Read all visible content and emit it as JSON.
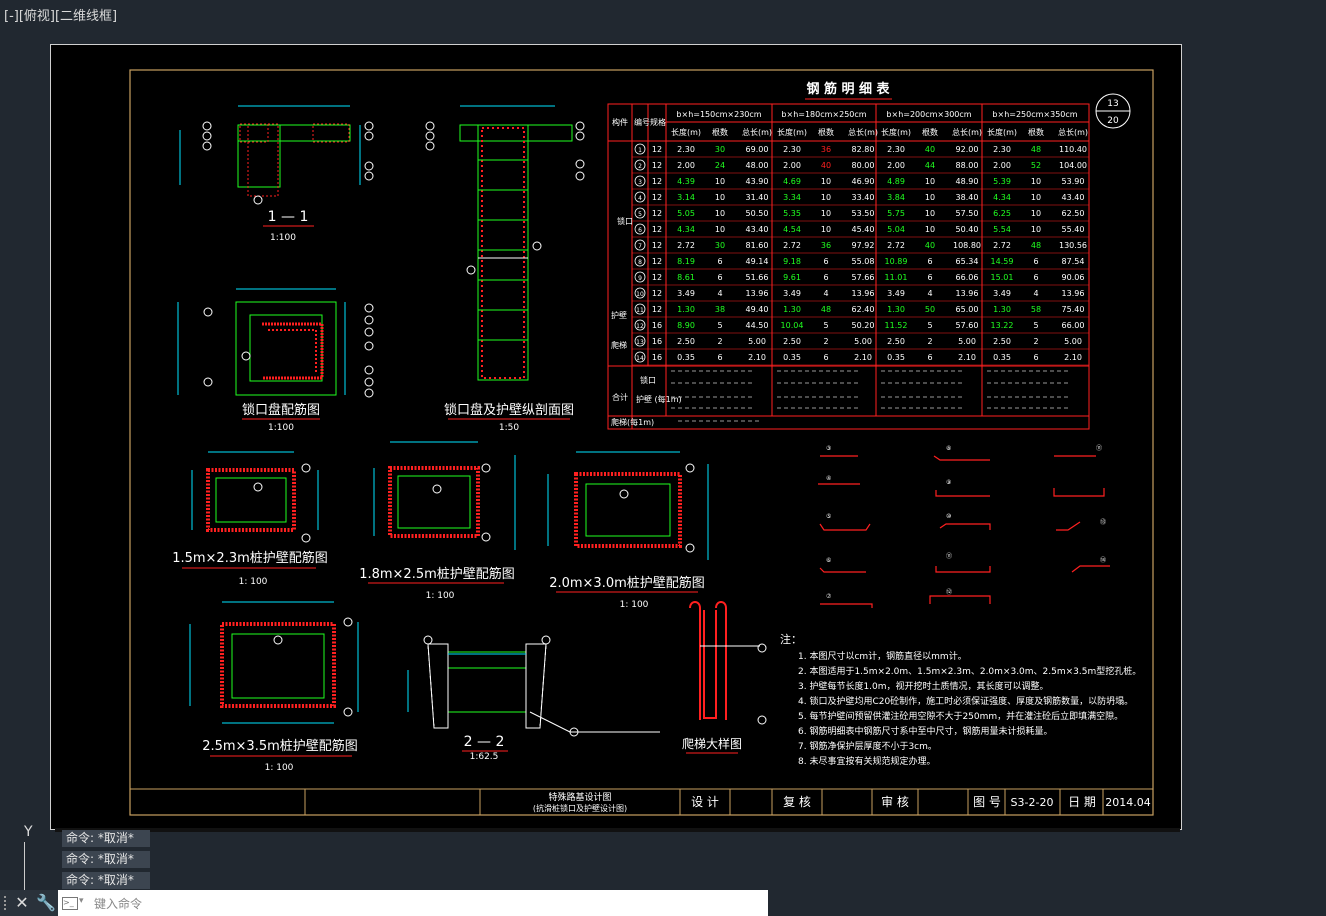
{
  "viewport": {
    "label": "[-][俯视][二维线框]"
  },
  "drawing": {
    "table_title": "钢 筋 明 细 表",
    "sheet_badge": {
      "num": "13",
      "den": "20"
    },
    "table_header": {
      "col1": "构件",
      "col2": "编号",
      "col3": "规格",
      "groups": [
        "b×h=150cm×230cm",
        "b×h=180cm×250cm",
        "b×h=200cm×300cm",
        "b×h=250cm×350cm"
      ],
      "sub": [
        "长度(m)",
        "根数",
        "总长(m)"
      ]
    },
    "table_rows": [
      [
        "1",
        "12",
        "2.30",
        "30",
        "69.00",
        "2.30",
        "36",
        "82.80",
        "2.30",
        "40",
        "92.00",
        "2.30",
        "48",
        "110.40"
      ],
      [
        "2",
        "12",
        "2.00",
        "24",
        "48.00",
        "2.00",
        "40",
        "80.00",
        "2.00",
        "44",
        "88.00",
        "2.00",
        "52",
        "104.00"
      ],
      [
        "3",
        "12",
        "4.39",
        "10",
        "43.90",
        "4.69",
        "10",
        "46.90",
        "4.89",
        "10",
        "48.90",
        "5.39",
        "10",
        "53.90"
      ],
      [
        "4",
        "12",
        "3.14",
        "10",
        "31.40",
        "3.34",
        "10",
        "33.40",
        "3.84",
        "10",
        "38.40",
        "4.34",
        "10",
        "43.40"
      ],
      [
        "5",
        "12",
        "5.05",
        "10",
        "50.50",
        "5.35",
        "10",
        "53.50",
        "5.75",
        "10",
        "57.50",
        "6.25",
        "10",
        "62.50"
      ],
      [
        "6",
        "12",
        "4.34",
        "10",
        "43.40",
        "4.54",
        "10",
        "45.40",
        "5.04",
        "10",
        "50.40",
        "5.54",
        "10",
        "55.40"
      ],
      [
        "7",
        "12",
        "2.72",
        "30",
        "81.60",
        "2.72",
        "36",
        "97.92",
        "2.72",
        "40",
        "108.80",
        "2.72",
        "48",
        "130.56"
      ],
      [
        "8",
        "12",
        "8.19",
        "6",
        "49.14",
        "9.18",
        "6",
        "55.08",
        "10.89",
        "6",
        "65.34",
        "14.59",
        "6",
        "87.54"
      ],
      [
        "9",
        "12",
        "8.61",
        "6",
        "51.66",
        "9.61",
        "6",
        "57.66",
        "11.01",
        "6",
        "66.06",
        "15.01",
        "6",
        "90.06"
      ],
      [
        "10",
        "12",
        "3.49",
        "4",
        "13.96",
        "3.49",
        "4",
        "13.96",
        "3.49",
        "4",
        "13.96",
        "3.49",
        "4",
        "13.96"
      ],
      [
        "11",
        "12",
        "1.30",
        "38",
        "49.40",
        "1.30",
        "48",
        "62.40",
        "1.30",
        "50",
        "65.00",
        "1.30",
        "58",
        "75.40"
      ],
      [
        "12",
        "16",
        "8.90",
        "5",
        "44.50",
        "10.04",
        "5",
        "50.20",
        "11.52",
        "5",
        "57.60",
        "13.22",
        "5",
        "66.00"
      ],
      [
        "13",
        "16",
        "2.50",
        "2",
        "5.00",
        "2.50",
        "2",
        "5.00",
        "2.50",
        "2",
        "5.00",
        "2.50",
        "2",
        "5.00"
      ],
      [
        "14",
        "16",
        "0.35",
        "6",
        "2.10",
        "0.35",
        "6",
        "2.10",
        "0.35",
        "6",
        "2.10",
        "0.35",
        "6",
        "2.10"
      ]
    ],
    "table_side_labels": {
      "top": "锁口",
      "guard": "护壁",
      "ladder": "爬梯"
    },
    "table_total": {
      "label": "合计",
      "r1": "锁口",
      "r2": "护壁 (每1m)",
      "r3": "爬梯(每1m)"
    },
    "views": {
      "sec11": "1 — 1",
      "sec11_scale": "1:100",
      "plan": "锁口盘配筋图",
      "plan_scale": "1:100",
      "long": "锁口盘及护壁纵剖面图",
      "long_scale": "1:50",
      "p1": "1.5m×2.3m桩护壁配筋图",
      "p1_scale": "1: 100",
      "p2": "1.8m×2.5m桩护壁配筋图",
      "p2_scale": "1: 100",
      "p3": "2.0m×3.0m桩护壁配筋图",
      "p3_scale": "1: 100",
      "p4": "2.5m×3.5m桩护壁配筋图",
      "p4_scale": "1: 100",
      "sec22": "2 — 2",
      "sec22_scale": "1:62.5",
      "ladder": "爬梯大样图"
    },
    "notes_title": "注：",
    "notes": [
      "1. 本图尺寸以cm计，钢筋直径以mm计。",
      "2. 本图适用于1.5m×2.0m、1.5m×2.3m、2.0m×3.0m、2.5m×3.5m型挖孔桩。",
      "3. 护壁每节长度1.0m，视开挖时土质情况，其长度可以调整。",
      "4. 锁口及护壁均用C20砼制作，施工时必须保证强度、厚度及钢筋数量，以防坍塌。",
      "5. 每节护壁间预留供灌注砼用空隙不大于250mm，并在灌注砼后立即填满空隙。",
      "6. 钢筋明细表中钢筋尺寸系中至中尺寸，钢筋用量未计损耗量。",
      "7. 钢筋净保护层厚度不小于3cm。",
      "8. 未尽事宜按有关规范规定办理。"
    ],
    "title_block": {
      "project": "特殊路基设计图",
      "subtitle": "(抗滑桩锁口及护壁设计图)",
      "design": "设 计",
      "review": "复 核",
      "approve": "审 核",
      "drawing_no_label": "图 号",
      "drawing_no": "S3-2-20",
      "date_label": "日 期",
      "date": "2014.04"
    }
  },
  "ucs": {
    "y_label": "Y"
  },
  "command_history": [
    "命令: *取消*",
    "命令: *取消*",
    "命令: *取消*"
  ],
  "command_line": {
    "placeholder": "键入命令"
  },
  "colors": {
    "red": "#ff2020",
    "cyan": "#00e5ff",
    "green": "#20ff20",
    "white": "#ffffff",
    "yellow": "#ffd040",
    "paper_border": "#c8a060"
  }
}
